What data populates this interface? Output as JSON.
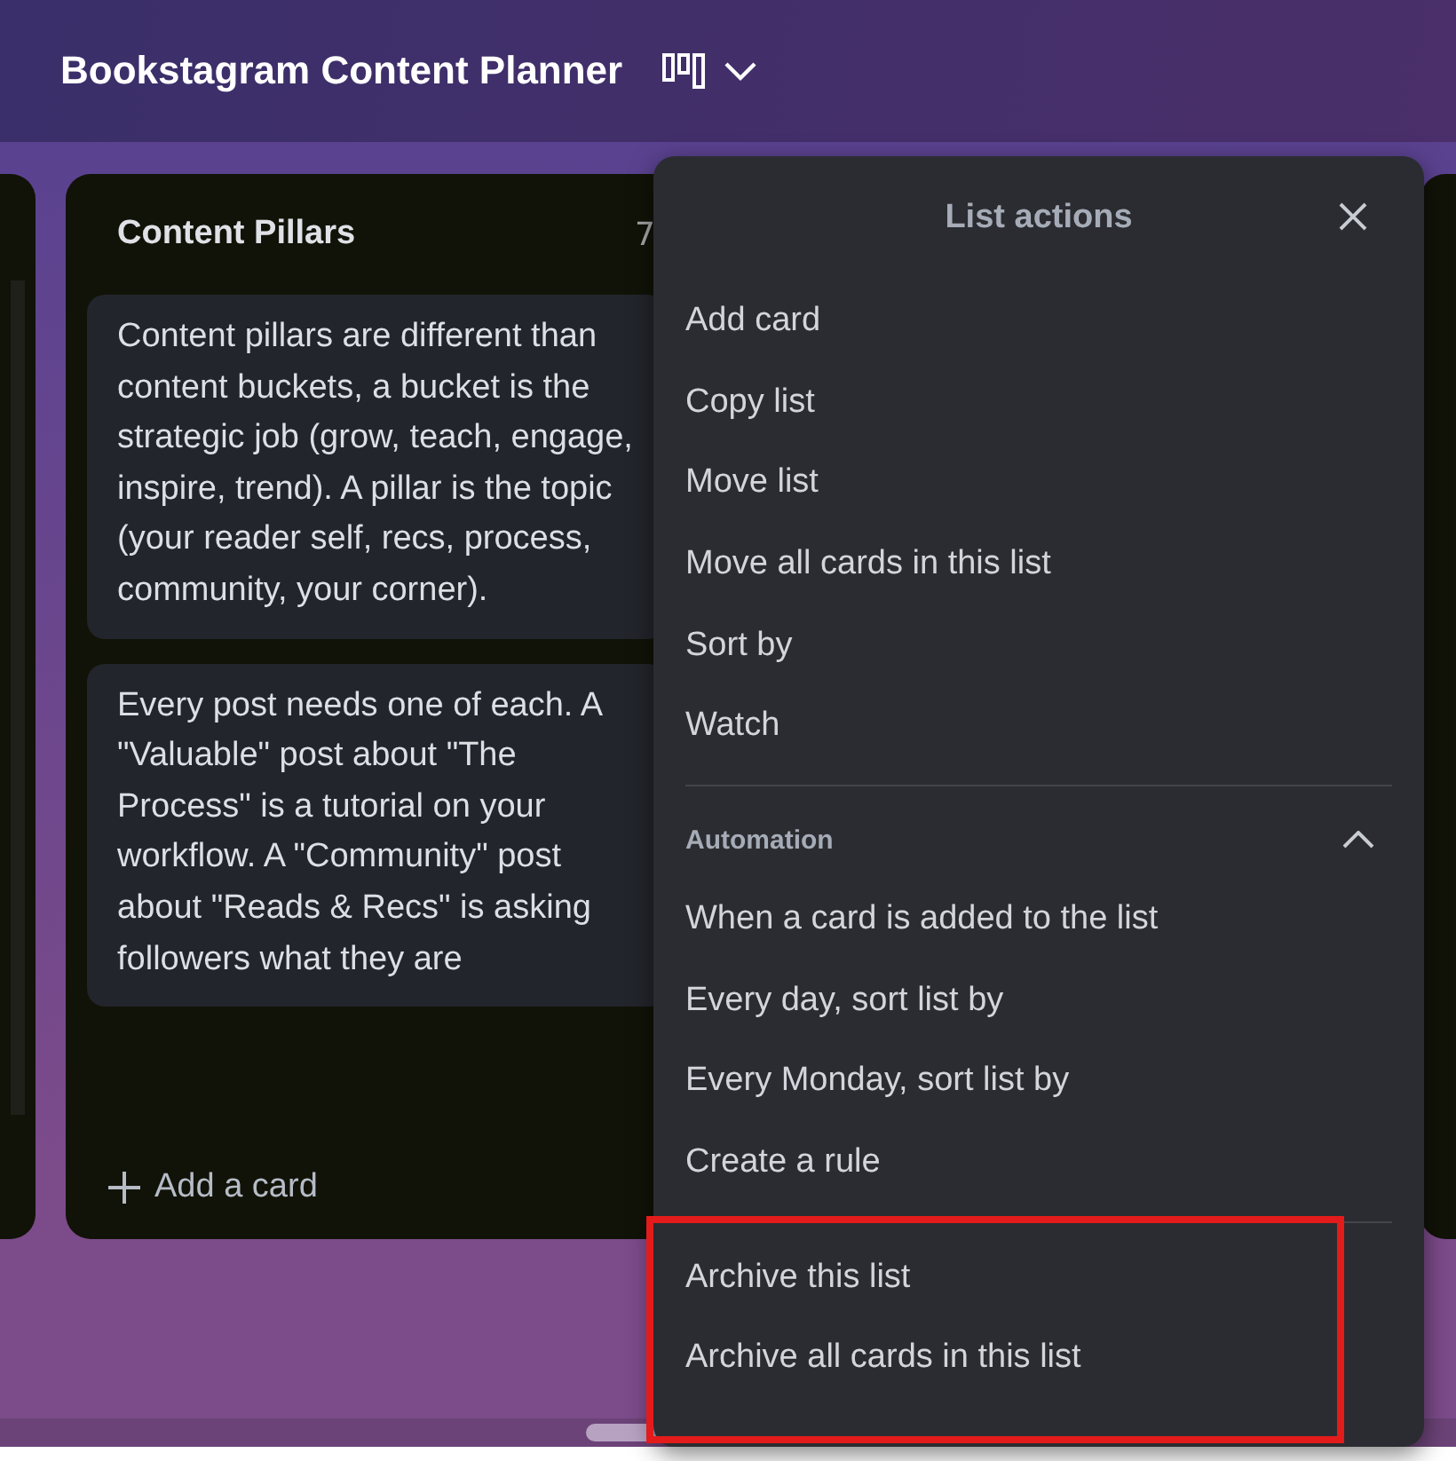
{
  "board": {
    "title": "Bookstagram Content Planner"
  },
  "list": {
    "title": "Content Pillars",
    "count": "7",
    "cards": [
      {
        "text": "Content pillars are different than content buckets, a bucket is the strategic job (grow, teach, engage, inspire, trend). A pillar is the topic (your reader self, recs, process, community, your corner)."
      },
      {
        "text": "Every post needs one of each. A \"Valuable\" post about \"The Process\" is a tutorial on your workflow. A \"Community\" post about \"Reads & Recs\" is asking followers what they are"
      }
    ],
    "add_card": "Add a card"
  },
  "menu": {
    "title": "List actions",
    "sections": [
      {
        "items": [
          "Add card",
          "Copy list",
          "Move list",
          "Move all cards in this list",
          "Sort by",
          "Watch"
        ]
      },
      {
        "heading": "Automation",
        "expanded": true,
        "items": [
          "When a card is added to the list",
          "Every day, sort list by",
          "Every Monday, sort list by",
          "Create a rule"
        ]
      },
      {
        "items": [
          "Archive this list",
          "Archive all cards in this list"
        ],
        "highlighted": true
      }
    ]
  }
}
